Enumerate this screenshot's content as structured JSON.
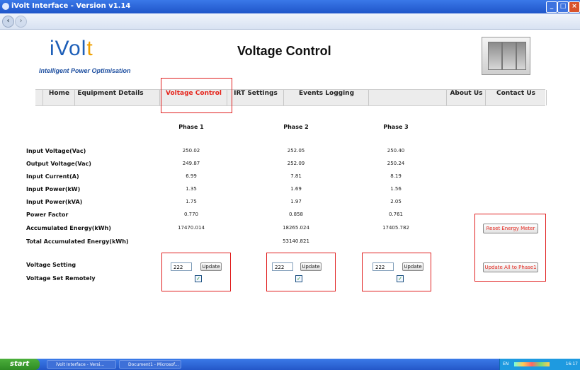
{
  "window": {
    "title": "iVolt Interface - Version v1.14"
  },
  "header": {
    "logo_main": "iVolt",
    "tagline": "Intelligent Power Optimisation",
    "page_title": "Voltage Control"
  },
  "menu": {
    "items": [
      {
        "label": "Home"
      },
      {
        "label": "Equipment Details"
      },
      {
        "label": "Voltage Control"
      },
      {
        "label": "IRT Settings"
      },
      {
        "label": "Events Logging"
      },
      {
        "label": ""
      },
      {
        "label": "About Us"
      },
      {
        "label": "Contact Us"
      }
    ],
    "active": "Voltage Control"
  },
  "table": {
    "phases": [
      "Phase 1",
      "Phase 2",
      "Phase 3"
    ],
    "rows": [
      {
        "label": "Input Voltage(Vac)",
        "values": [
          "250.02",
          "252.05",
          "250.40"
        ]
      },
      {
        "label": "Output Voltage(Vac)",
        "values": [
          "249.87",
          "252.09",
          "250.24"
        ]
      },
      {
        "label": "Input Current(A)",
        "values": [
          "6.99",
          "7.81",
          "8.19"
        ]
      },
      {
        "label": "Input Power(kW)",
        "values": [
          "1.35",
          "1.69",
          "1.56"
        ]
      },
      {
        "label": "Input Power(kVA)",
        "values": [
          "1.75",
          "1.97",
          "2.05"
        ]
      },
      {
        "label": "Power Factor",
        "values": [
          "0.770",
          "0.858",
          "0.761"
        ]
      },
      {
        "label": "Accumulated Energy(kWh)",
        "values": [
          "17470.014",
          "18265.024",
          "17405.782"
        ]
      }
    ],
    "total_label": "Total Accumulated Energy(kWh)",
    "total_value": "53140.821"
  },
  "controls": {
    "voltage_setting_label": "Voltage Setting",
    "voltage_set_remotely_label": "Voltage Set Remotely",
    "voltage_values": [
      "222",
      "222",
      "222"
    ],
    "update_label": "Update",
    "remote_checked": [
      true,
      true,
      true
    ],
    "check_glyph": "✓",
    "reset_label": "Reset Energy Meter",
    "update_all_label": "Update All to Phase1"
  },
  "taskbar": {
    "start_label": "start",
    "tasks": [
      "iVolt Interface - Versi...",
      "Document1 - Microsof..."
    ],
    "tray_lang": "EN",
    "clock": "16:17"
  },
  "colors": {
    "accent_red": "#e5261d",
    "logo_blue": "#1e5fb8",
    "logo_orange": "#f0a000",
    "xp_blue": "#2457c8"
  }
}
